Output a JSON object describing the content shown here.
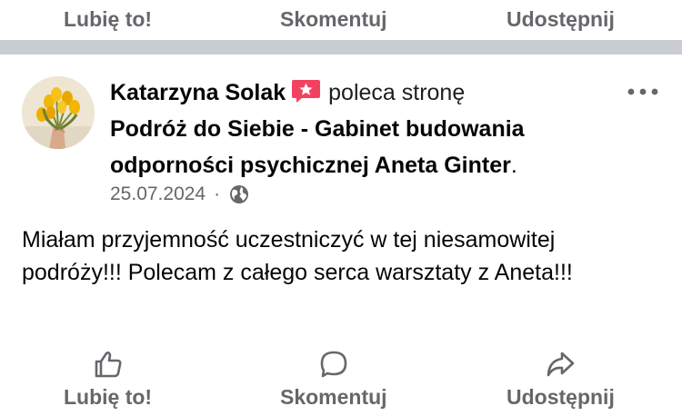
{
  "top_actions": {
    "like_label": "Lubię to!",
    "comment_label": "Skomentuj",
    "share_label": "Udostępnij"
  },
  "post": {
    "author": "Katarzyna Solak",
    "recommends_text": "poleca stronę",
    "page_name": "Podróż do Siebie - Gabinet budowania odporności psychicznej Aneta Ginter",
    "page_name_suffix": ".",
    "date": "25.07.2024",
    "separator": "·",
    "audience_icon": "globe-icon",
    "more_icon": "more-options-icon",
    "badge_icon": "star-recommendation-icon",
    "text": "Miałam przyjemność uczestniczyć w tej niesamowitej podróży!!! Polecam z całego serca warsztaty z Aneta!!!"
  },
  "bottom_actions": {
    "like_label": "Lubię to!",
    "comment_label": "Skomentuj",
    "share_label": "Udostępnij"
  },
  "colors": {
    "secondary_text": "#65676b",
    "divider": "#c9ccd1",
    "badge": "#f3425f"
  }
}
